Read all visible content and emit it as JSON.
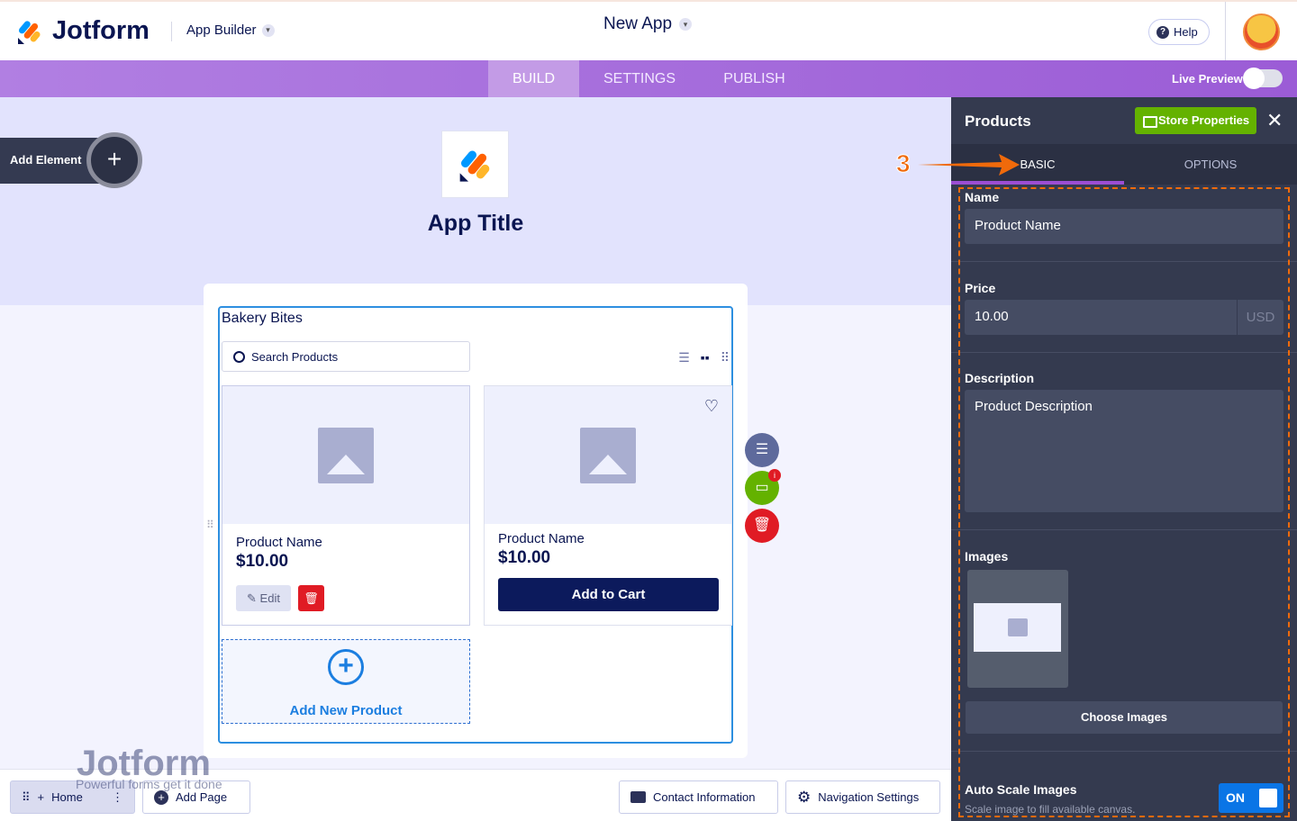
{
  "header": {
    "brand": "Jotform",
    "product": "App Builder",
    "app_name": "New App",
    "help": "Help"
  },
  "nav": {
    "tabs": [
      "BUILD",
      "SETTINGS",
      "PUBLISH"
    ],
    "active": "BUILD",
    "live_preview": "Live Preview",
    "live_preview_on": false
  },
  "canvas": {
    "add_element": "Add Element",
    "app_title": "App Title"
  },
  "widget": {
    "title": "Bakery Bites",
    "search_placeholder": "Search Products",
    "products": [
      {
        "name": "Product Name",
        "price": "$10.00",
        "edit": "Edit"
      },
      {
        "name": "Product Name",
        "price": "$10.00",
        "cta": "Add to Cart"
      }
    ],
    "add_new": "Add New Product"
  },
  "bottom": {
    "home": "Home",
    "add_page": "Add Page",
    "contact": "Contact Information",
    "nav_settings": "Navigation Settings",
    "watermark_brand": "Jotform",
    "watermark_tag": "Powerful forms get it done"
  },
  "panel": {
    "title": "Products",
    "store_properties": "Store Properties",
    "tabs": [
      "BASIC",
      "OPTIONS"
    ],
    "active_tab": "BASIC",
    "annotation": "3",
    "name_label": "Name",
    "name_value": "Product Name",
    "price_label": "Price",
    "price_value": "10.00",
    "currency": "USD",
    "desc_label": "Description",
    "desc_value": "Product Description",
    "images_label": "Images",
    "choose_images": "Choose Images",
    "auto_scale_label": "Auto Scale Images",
    "auto_scale_desc": "Scale image to fill available canvas.",
    "auto_scale_state": "ON"
  },
  "colors": {
    "accent": "#9b5cd6",
    "green": "#64b200",
    "navy": "#0c1a5c",
    "annotation": "#f06a0b"
  }
}
